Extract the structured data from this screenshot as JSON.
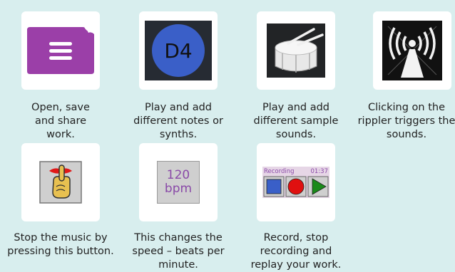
{
  "items": [
    {
      "id": "open-save-share",
      "icon": "folder-menu-icon",
      "lines": [
        "Open, save",
        "and share",
        "work."
      ]
    },
    {
      "id": "notes",
      "icon": "note-circle-icon",
      "icon_text": "D4",
      "lines": [
        "Play and add",
        "different notes or",
        "synths."
      ]
    },
    {
      "id": "samples",
      "icon": "drum-icon",
      "lines": [
        "Play and add",
        "different sample",
        "sounds."
      ]
    },
    {
      "id": "rippler",
      "icon": "broadcast-tower-icon",
      "lines": [
        "Clicking on the",
        "rippler triggers the",
        "sounds."
      ]
    },
    {
      "id": "stop",
      "icon": "hush-hand-icon",
      "lines": [
        "Stop the music by",
        "pressing this button."
      ]
    },
    {
      "id": "tempo",
      "icon": "tempo-icon",
      "icon_text": [
        "120",
        "bpm"
      ],
      "lines": [
        "This changes the",
        "speed – beats per",
        "minute."
      ]
    },
    {
      "id": "record",
      "icon": "record-panel-icon",
      "panel": {
        "label": "Recording",
        "time": "01:37"
      },
      "lines": [
        "Record, stop",
        "recording and",
        "replay your work."
      ]
    }
  ],
  "colors": {
    "background": "#d8eeee",
    "folder": "#9b3fa8",
    "note_circle": "#3a5fc8",
    "stop_button": "#3a5fc8",
    "record_button": "#e01010",
    "play_button": "#1a8a1a"
  }
}
